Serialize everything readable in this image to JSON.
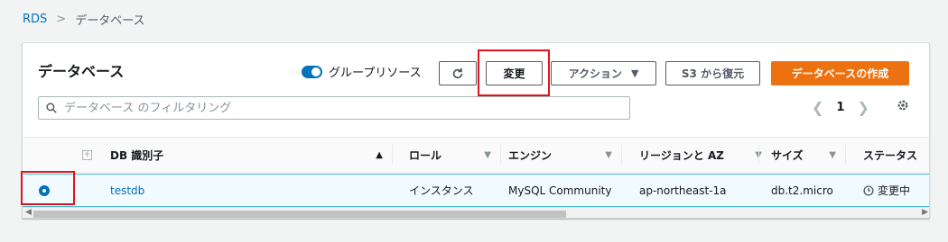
{
  "breadcrumb": {
    "root": "RDS",
    "separator": ">",
    "current": "データベース"
  },
  "panel": {
    "title": "データベース",
    "group_toggle_label": "グループリソース",
    "buttons": {
      "modify": "変更",
      "actions": "アクション",
      "s3_restore": "S3 から復元",
      "create": "データベースの作成"
    },
    "search": {
      "placeholder": "データベース のフィルタリング"
    },
    "pager": {
      "page": "1"
    }
  },
  "table": {
    "columns": [
      "DB 識別子",
      "ロール",
      "エンジン",
      "リージョンと AZ",
      "サイズ",
      "ステータス"
    ],
    "rows": [
      {
        "identifier": "testdb",
        "role": "インスタンス",
        "engine": "MySQL Community",
        "region": "ap-northeast-1a",
        "size": "db.t2.micro",
        "status": "変更中"
      }
    ]
  },
  "colors": {
    "accent": "#0073bb",
    "primary_button": "#ec7211",
    "highlight": "#e0141e"
  }
}
